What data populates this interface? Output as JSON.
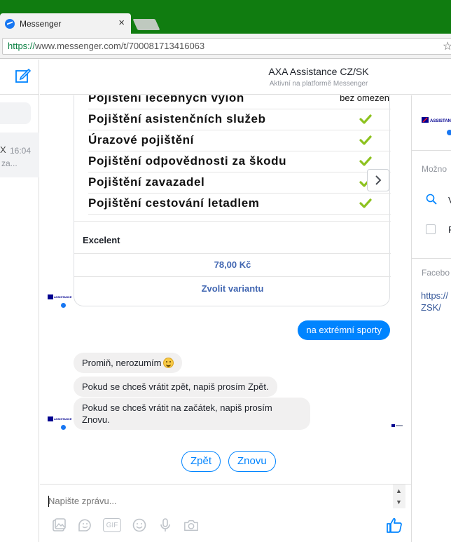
{
  "browser": {
    "tab_title": "Messenger",
    "tab_close": "×",
    "url_scheme": "https://",
    "url_rest": "www.messenger.com/t/700081713416063",
    "bookmark_star": "☆"
  },
  "left": {
    "conversation": {
      "time": "16:04",
      "snippet": "za...",
      "close_mark": "X"
    }
  },
  "header": {
    "name": "AXA Assistance CZ/SK",
    "status": "Aktivní na platformě Messenger"
  },
  "card": {
    "rows": [
      {
        "name": "Pojištění léčebných výloh",
        "value": "bez omezen",
        "checked": false
      },
      {
        "name": "Pojištění asistenčních služeb",
        "checked": true
      },
      {
        "name": "Úrazové pojištění",
        "checked": true
      },
      {
        "name": "Pojištění odpovědnosti za škodu",
        "checked": true
      },
      {
        "name": "Pojištění zavazadel",
        "checked": true
      },
      {
        "name": "Pojištění cestování letadlem",
        "checked": true
      }
    ],
    "variant": "Excelent",
    "price": "78,00 Kč",
    "choose_label": "Zvolit variantu"
  },
  "messages": {
    "outgoing": "na extrémní sporty",
    "sorry": "Promiň, nerozumím",
    "back_hint": "Pokud se chceš vrátit zpět, napiš prosím Zpět.",
    "restart_hint": "Pokud se chceš vrátit na začátek, napiš prosím Znovu."
  },
  "quick_replies": [
    "Zpět",
    "Znovu"
  ],
  "composer": {
    "placeholder": "Napište zprávu...",
    "tools": [
      "image-icon",
      "sticker-icon",
      "gif-icon",
      "emoji-icon",
      "microphone-icon",
      "camera-icon"
    ],
    "gif_label": "GIF"
  },
  "right": {
    "heading": "Možno",
    "search_letter": "V",
    "option_letter": "P",
    "facebook_heading": "Facebo",
    "link": "https://ZSK/"
  },
  "colors": {
    "chrome_green": "#107c10",
    "messenger_blue": "#0084ff",
    "check_green": "#8dc21f",
    "link_blue": "#4267b2"
  }
}
